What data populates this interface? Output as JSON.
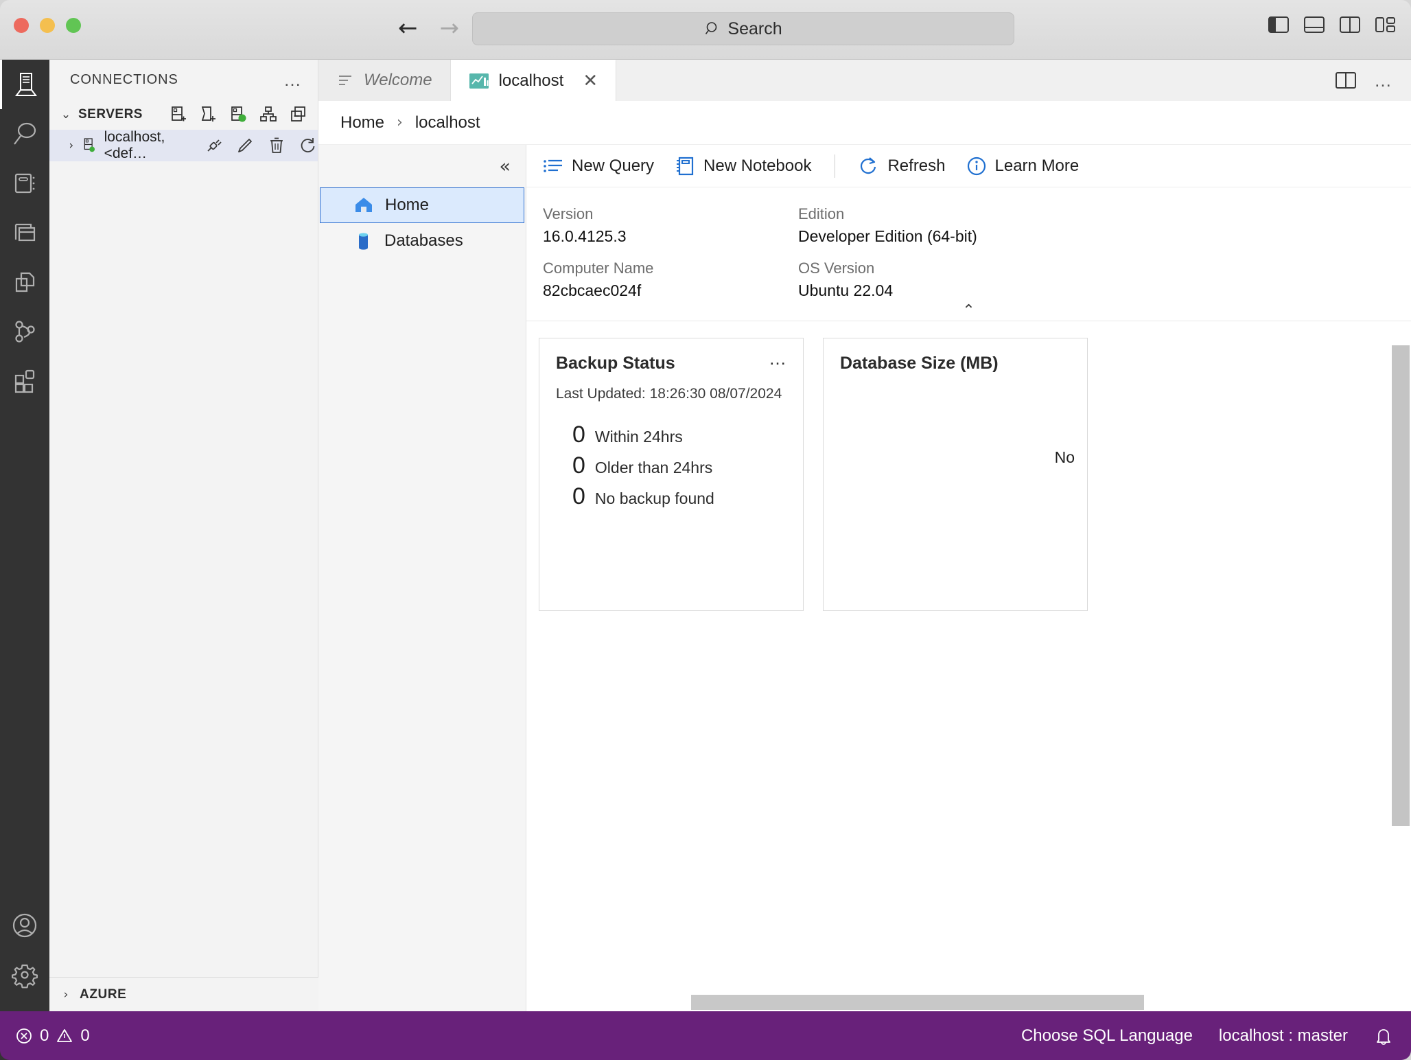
{
  "window": {
    "search_placeholder": "Search",
    "nav_back": "back-arrow",
    "nav_forward": "forward-arrow"
  },
  "activity_bar": {
    "items": [
      {
        "icon": "server-icon",
        "name": "connections",
        "active": true
      },
      {
        "icon": "search-icon",
        "name": "search",
        "active": false
      },
      {
        "icon": "notebook-icon",
        "name": "notebooks",
        "active": false
      },
      {
        "icon": "dashboard-icon",
        "name": "dashboards",
        "active": false
      },
      {
        "icon": "copy-files-icon",
        "name": "files",
        "active": false
      },
      {
        "icon": "source-control-icon",
        "name": "source-control",
        "active": false
      },
      {
        "icon": "extensions-icon",
        "name": "extensions",
        "active": false
      }
    ],
    "bottom_items": [
      {
        "icon": "account-icon",
        "name": "accounts"
      },
      {
        "icon": "gear-icon",
        "name": "manage"
      }
    ]
  },
  "sidebar": {
    "title": "CONNECTIONS",
    "more_actions": "…",
    "servers_section": {
      "label": "SERVERS",
      "expanded": true,
      "chevron": "⌄",
      "actions": [
        {
          "name": "new-connection-icon",
          "tooltip": "New Connection"
        },
        {
          "name": "new-server-group-icon",
          "tooltip": "New Server Group"
        },
        {
          "name": "active-connections-icon",
          "tooltip": "Active Connections"
        },
        {
          "name": "connection-tree-icon",
          "tooltip": "Connection Tree"
        },
        {
          "name": "collapse-all-icon",
          "tooltip": "Collapse All"
        }
      ]
    },
    "server_node": {
      "label": "localhost, <def…",
      "chevron": "›",
      "status": "connected",
      "actions": [
        {
          "name": "disconnect-icon",
          "tooltip": "Disconnect"
        },
        {
          "name": "edit-connection-icon",
          "tooltip": "Edit Connection"
        },
        {
          "name": "delete-connection-icon",
          "tooltip": "Delete Connection"
        },
        {
          "name": "refresh-icon",
          "tooltip": "Refresh"
        }
      ]
    },
    "azure_section": {
      "label": "AZURE",
      "expanded": false,
      "chevron": "›"
    }
  },
  "tabs": [
    {
      "label": "Welcome",
      "icon": "welcome-icon",
      "active": false,
      "closable": false
    },
    {
      "label": "localhost",
      "icon": "dashboard-chart-icon",
      "active": true,
      "closable": true,
      "close": "✕"
    }
  ],
  "tabbar_actions": [
    {
      "name": "split-editor-icon"
    },
    {
      "name": "more-actions-icon",
      "glyph": "…"
    }
  ],
  "breadcrumb": {
    "items": [
      "Home",
      "localhost"
    ],
    "separator": "›"
  },
  "nav_pane": {
    "collapse_glyph": "«",
    "items": [
      {
        "label": "Home",
        "icon": "home-icon",
        "selected": true
      },
      {
        "label": "Databases",
        "icon": "database-icon",
        "selected": false
      }
    ]
  },
  "toolbar": {
    "new_query": "New Query",
    "new_notebook": "New Notebook",
    "refresh": "Refresh",
    "learn_more": "Learn More"
  },
  "server_properties": {
    "collapse_glyph": "⌃",
    "left": [
      {
        "key": "Version",
        "value": "16.0.4125.3"
      },
      {
        "key": "Computer Name",
        "value": "82cbcaec024f"
      }
    ],
    "right": [
      {
        "key": "Edition",
        "value": "Developer Edition (64-bit)"
      },
      {
        "key": "OS Version",
        "value": "Ubuntu 22.04"
      }
    ]
  },
  "widgets": [
    {
      "title": "Backup Status",
      "menu_glyph": "…",
      "subtitle": "Last Updated: 18:26:30 08/07/2024",
      "stats": [
        {
          "count": "0",
          "label": "Within 24hrs"
        },
        {
          "count": "0",
          "label": "Older than 24hrs"
        },
        {
          "count": "0",
          "label": "No backup found"
        }
      ]
    },
    {
      "title": "Database Size (MB)",
      "empty_text": "No"
    }
  ],
  "status_bar": {
    "errors": "0",
    "warnings": "0",
    "error_icon": "error-circle-icon",
    "warning_icon": "warning-triangle-icon",
    "sql_language": "Choose SQL Language",
    "connection": "localhost : master",
    "bell_icon": "bell-icon"
  },
  "colors": {
    "accent_purple": "#68217a",
    "link_blue": "#0f6cbd",
    "selection_blue": "#dbeafd",
    "connected_green": "#3fae3b"
  }
}
